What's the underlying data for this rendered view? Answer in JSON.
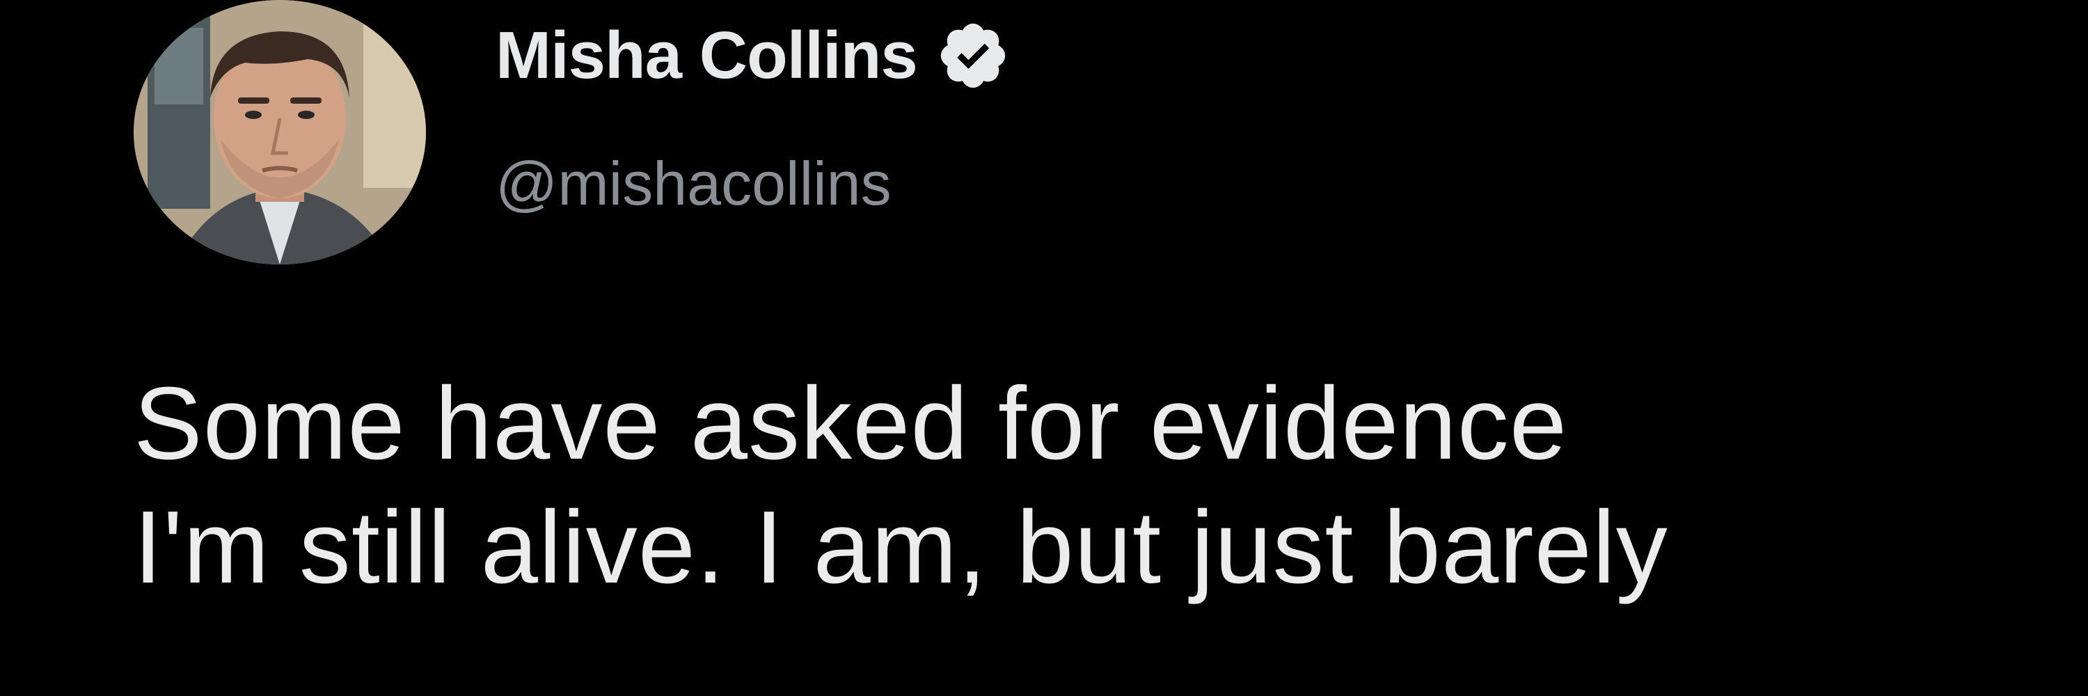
{
  "tweet": {
    "author": {
      "display_name": "Misha Collins",
      "handle": "@mishacollins",
      "verified": true,
      "avatar_icon": "profile-photo",
      "verified_icon": "verified-badge-icon"
    },
    "text": "Some have asked for evidence\nI'm still alive. I am, but just barely"
  },
  "colors": {
    "background": "#000000",
    "name": "#e7e9ea",
    "handle": "#8b8f95",
    "text": "#ececec"
  }
}
